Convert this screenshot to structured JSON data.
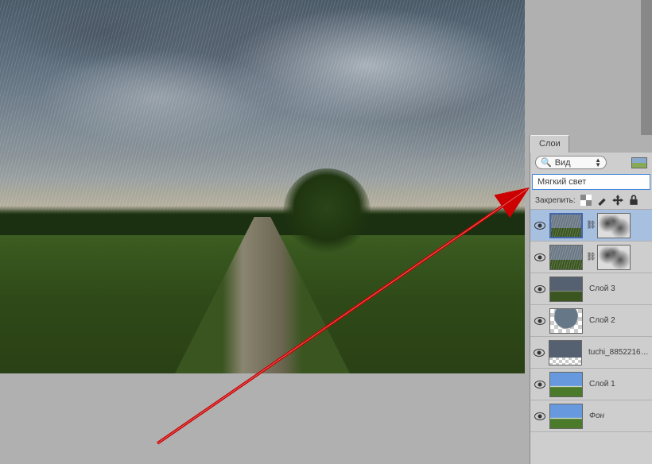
{
  "panel": {
    "tab_label": "Слои",
    "filter_label": "Вид",
    "blend_mode": "Мягкий свет",
    "lock_label": "Закрепить:"
  },
  "layers": [
    {
      "name": "",
      "selected": true,
      "has_mask": true,
      "linked": true,
      "thumb": "rain",
      "visible": true
    },
    {
      "name": "",
      "selected": false,
      "has_mask": true,
      "linked": true,
      "thumb": "rain",
      "visible": true
    },
    {
      "name": "Слой 3",
      "selected": false,
      "has_mask": false,
      "thumb": "storm",
      "visible": true
    },
    {
      "name": "Слой 2",
      "selected": false,
      "has_mask": false,
      "thumb": "checker",
      "visible": true
    },
    {
      "name": "tuchi_88522166…",
      "selected": false,
      "has_mask": false,
      "thumb": "tuchi",
      "visible": true
    },
    {
      "name": "Слой 1",
      "selected": false,
      "has_mask": false,
      "thumb": "clear",
      "visible": true
    },
    {
      "name": "Фон",
      "selected": false,
      "has_mask": false,
      "thumb": "clear",
      "italic": true,
      "visible": true
    }
  ]
}
